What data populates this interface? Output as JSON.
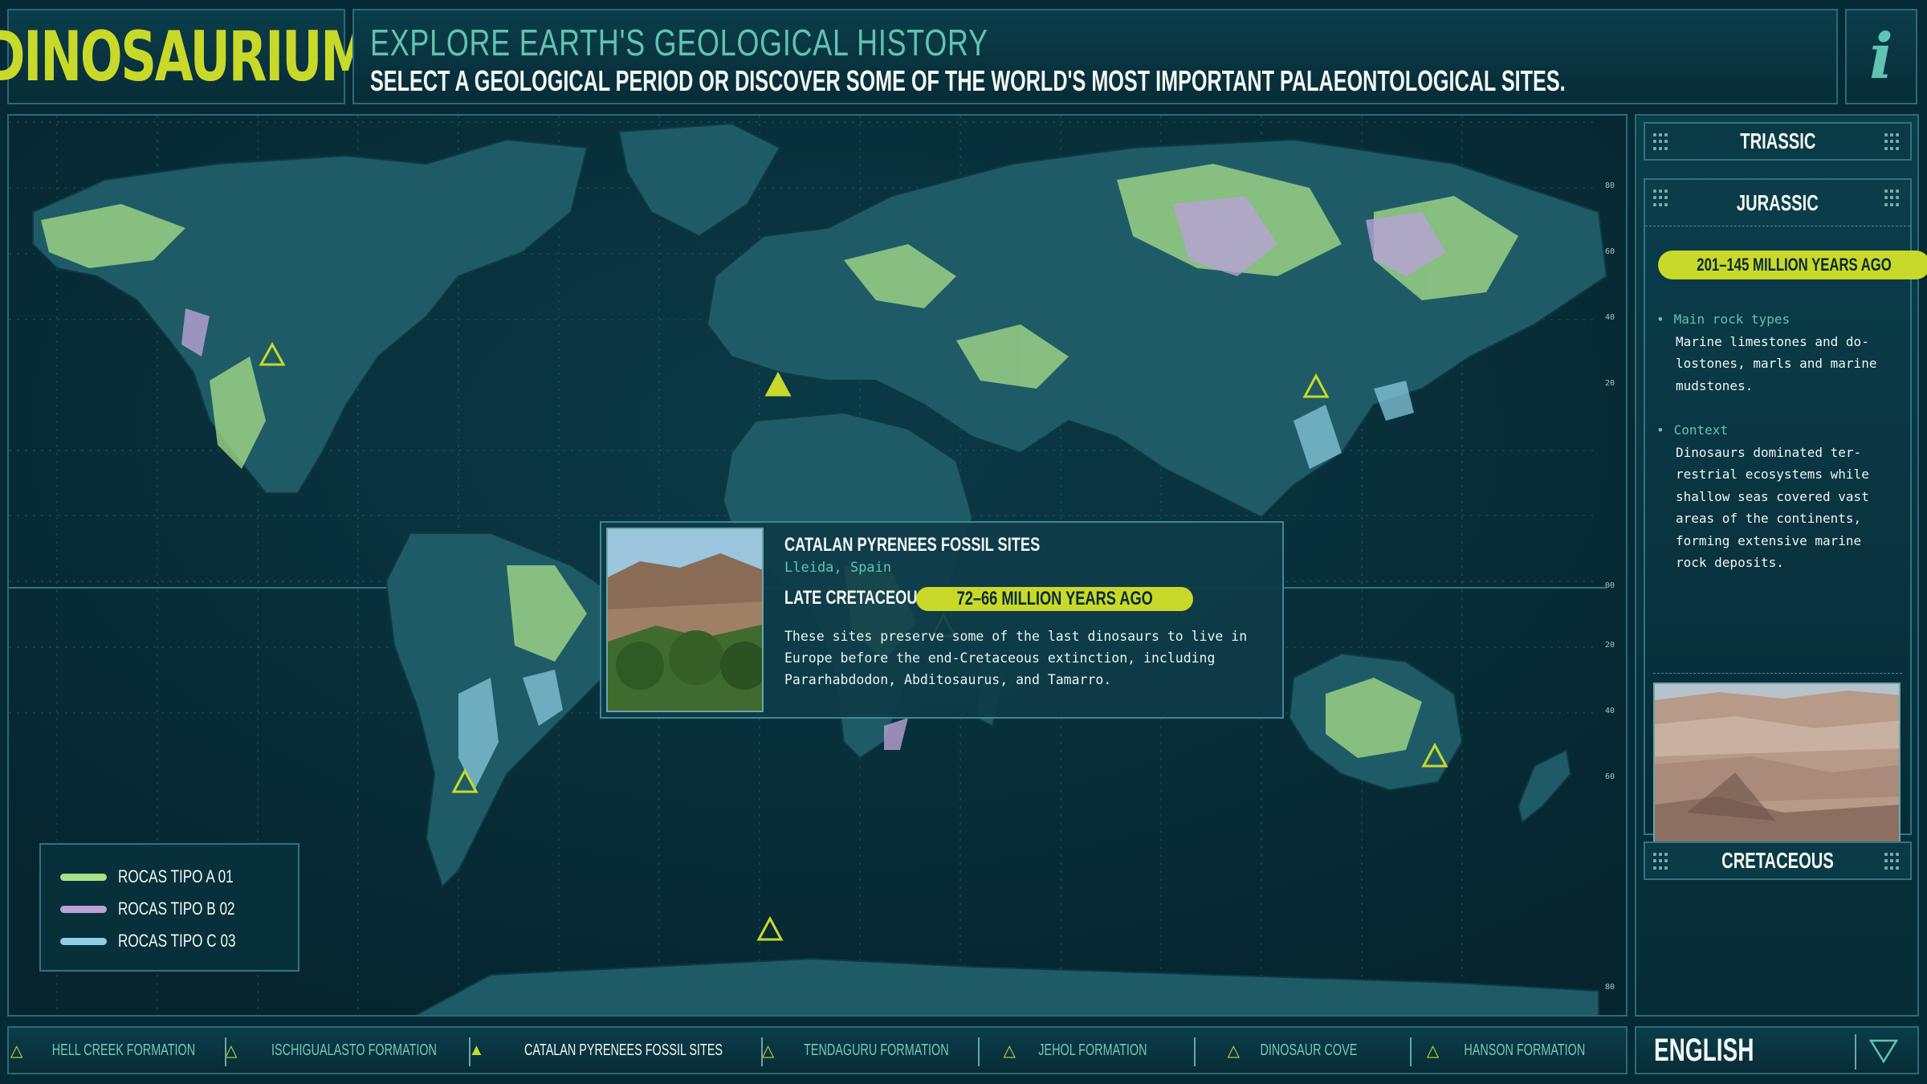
{
  "header": {
    "logo": "DINOSAURIUM",
    "title": "EXPLORE EARTH'S GEOLOGICAL HISTORY",
    "subtitle": "SELECT A GEOLOGICAL PERIOD OR DISCOVER SOME OF THE WORLD'S MOST IMPORTANT PALAEONTOLOGICAL SITES.",
    "info_icon": "info-icon"
  },
  "map": {
    "lat_labels": [
      "80",
      "60",
      "40",
      "20",
      "00",
      "20",
      "40",
      "60",
      "80"
    ],
    "sites": [
      {
        "name": "Hell Creek Formation",
        "icon": "triangle-outline"
      },
      {
        "name": "Catalan Pyrenees Fossil Sites",
        "icon": "triangle-filled"
      },
      {
        "name": "Jehol Formation",
        "icon": "triangle-outline"
      },
      {
        "name": "Tendaguru Formation",
        "icon": "triangle-outline"
      },
      {
        "name": "Hanson Formation",
        "icon": "triangle-outline"
      },
      {
        "name": "Ischigualasto Formation",
        "icon": "triangle-outline"
      },
      {
        "name": "Dinosaur Cove",
        "icon": "triangle-outline"
      }
    ]
  },
  "popup": {
    "title": "CATALAN PYRENEES FOSSIL SITES",
    "location": "Lleida, Spain",
    "period": "LATE CRETACEOUS",
    "age": "72–66 MILLION YEARS AGO",
    "text_lines": [
      "These sites preserve some of the last dinosaurs to live in",
      "Europe before the end-Cretaceous extinction, including",
      "Pararhabdodon, Abditosaurus, and Tamarro."
    ]
  },
  "legend": {
    "items": [
      {
        "label": "ROCAS TIPO A 01",
        "color": "#a9e08a"
      },
      {
        "label": "ROCAS TIPO B 02",
        "color": "#b9a2d6"
      },
      {
        "label": "ROCAS TIPO C 03",
        "color": "#8ed0e6"
      }
    ]
  },
  "sidebar": {
    "periods": {
      "triassic": "TRIASSIC",
      "jurassic": "JURASSIC",
      "cretaceous": "CRETACEOUS"
    },
    "jurassic": {
      "age": "201–145 MILLION YEARS AGO",
      "rock_heading": "Main rock types",
      "rock_lines": [
        "Marine limestones and do-",
        "lostones, marls and marine",
        "mudstones."
      ],
      "context_heading": "Context",
      "context_lines": [
        "Dinosaurs dominated ter-",
        "restrial ecosystems while",
        "shallow seas covered vast",
        "areas of the continents,",
        "forming extensive marine",
        "rock deposits."
      ]
    }
  },
  "footer": {
    "sites": [
      "HELL CREEK FORMATION",
      "ISCHIGUALASTO FORMATION",
      "CATALAN PYRENEES FOSSIL SITES",
      "TENDAGURU FORMATION",
      "JEHOL FORMATION",
      "DINOSAUR COVE",
      "HANSON FORMATION"
    ],
    "active_index": 2,
    "language": "ENGLISH"
  },
  "colors": {
    "accent": "#c8d92a",
    "teal": "#5fc4b2",
    "land": "#1f5b66",
    "rock_a": "#a9e08a",
    "rock_b": "#b9a2d6",
    "rock_c": "#8ed0e6"
  }
}
